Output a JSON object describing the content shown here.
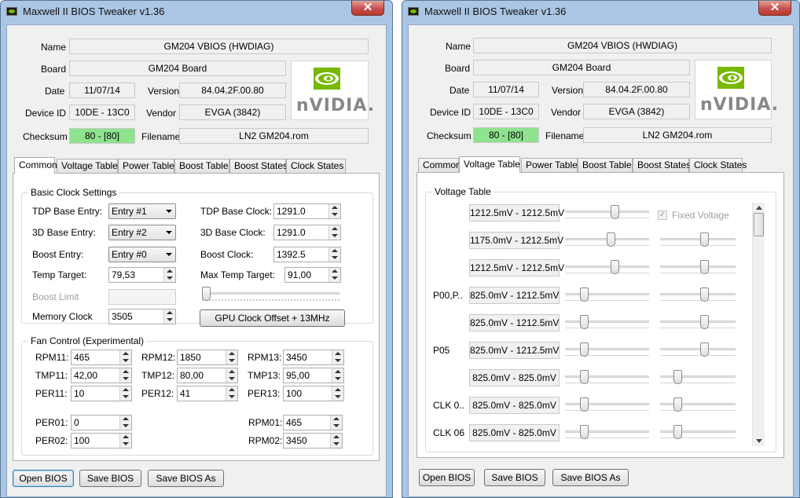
{
  "window_title": "Maxwell II BIOS Tweaker v1.36",
  "close_glyph": "✕",
  "info": {
    "name_label": "Name",
    "name_value": "GM204 VBIOS (HWDIAG)",
    "board_label": "Board",
    "board_value": "GM204 Board",
    "date_label": "Date",
    "date_value": "11/07/14",
    "version_label": "Version",
    "version_value": "84.04.2F.00.80",
    "device_label": "Device ID",
    "device_value": "10DE - 13C0",
    "vendor_label": "Vendor",
    "vendor_value": "EVGA (3842)",
    "checksum_label": "Checksum",
    "checksum_value": "80 - [80]",
    "filename_label": "Filename",
    "filename_value": "LN2 GM204.rom",
    "logo_text": "nVIDIA."
  },
  "colors": {
    "accent_green": "#8fe38f",
    "nvidia_green": "#78b900"
  },
  "tabs": [
    "Common",
    "Voltage Table",
    "Power Table",
    "Boost Table",
    "Boost States",
    "Clock States"
  ],
  "left_active_tab": "Common",
  "right_active_tab": "Voltage Table",
  "common": {
    "basic_group_title": "Basic Clock Settings",
    "tdp_base_entry_label": "TDP Base Entry:",
    "tdp_base_entry_value": "Entry #1",
    "base3d_entry_label": "3D Base Entry:",
    "base3d_entry_value": "Entry #2",
    "boost_entry_label": "Boost Entry:",
    "boost_entry_value": "Entry #0",
    "temp_target_label": "Temp Target:",
    "temp_target_value": "79,53",
    "boost_limit_label": "Boost Limit",
    "memory_clock_label": "Memory Clock",
    "memory_clock_value": "3505",
    "tdp_base_clock_label": "TDP Base Clock:",
    "tdp_base_clock_value": "1291.0",
    "base3d_clock_label": "3D Base Clock:",
    "base3d_clock_value": "1291.0",
    "boost_clock_label": "Boost Clock:",
    "boost_clock_value": "1392.5",
    "max_temp_label": "Max Temp Target:",
    "max_temp_value": "91,00",
    "gpu_offset_button": "GPU Clock Offset + 13MHz",
    "fan_group_title": "Fan Control (Experimental)",
    "fan": [
      [
        {
          "label": "RPM11:",
          "value": "465"
        },
        {
          "label": "RPM12:",
          "value": "1850"
        },
        {
          "label": "RPM13:",
          "value": "3450"
        }
      ],
      [
        {
          "label": "TMP11:",
          "value": "42,00"
        },
        {
          "label": "TMP12:",
          "value": "80,00"
        },
        {
          "label": "TMP13:",
          "value": "95,00"
        }
      ],
      [
        {
          "label": "PER11:",
          "value": "10"
        },
        {
          "label": "PER12:",
          "value": "41"
        },
        {
          "label": "PER13:",
          "value": "100"
        }
      ]
    ],
    "per01_label": "PER01:",
    "per01_value": "0",
    "per02_label": "PER02:",
    "per02_value": "100",
    "rpm01_label": "RPM01:",
    "rpm01_value": "465",
    "rpm02_label": "RPM02:",
    "rpm02_value": "3450"
  },
  "voltage": {
    "group_title": "Voltage Table",
    "fixed_voltage_label": "Fixed Voltage",
    "fixed_voltage_checked": true,
    "check_glyph": "✓",
    "rows": [
      {
        "label": "",
        "range": "1212.5mV - 1212.5mV",
        "slider1": 0.6,
        "slider2": null
      },
      {
        "label": "",
        "range": "1175.0mV - 1212.5mV",
        "slider1": 0.55,
        "slider2": 0.6
      },
      {
        "label": "",
        "range": "1212.5mV - 1212.5mV",
        "slider1": 0.6,
        "slider2": 0.6
      },
      {
        "label": "P00,P..",
        "range": "825.0mV - 1212.5mV",
        "slider1": 0.2,
        "slider2": 0.6
      },
      {
        "label": "",
        "range": "825.0mV - 1212.5mV",
        "slider1": 0.2,
        "slider2": 0.6
      },
      {
        "label": "P05",
        "range": "825.0mV - 1212.5mV",
        "slider1": 0.2,
        "slider2": 0.6
      },
      {
        "label": "",
        "range": "825.0mV - 825.0mV",
        "slider1": 0.2,
        "slider2": 0.2
      },
      {
        "label": "CLK 0..",
        "range": "825.0mV - 825.0mV",
        "slider1": 0.2,
        "slider2": 0.2
      },
      {
        "label": "CLK 06",
        "range": "825.0mV - 825.0mV",
        "slider1": 0.2,
        "slider2": 0.2
      }
    ]
  },
  "buttons": {
    "open": "Open BIOS",
    "save": "Save BIOS",
    "save_as": "Save BIOS As"
  }
}
